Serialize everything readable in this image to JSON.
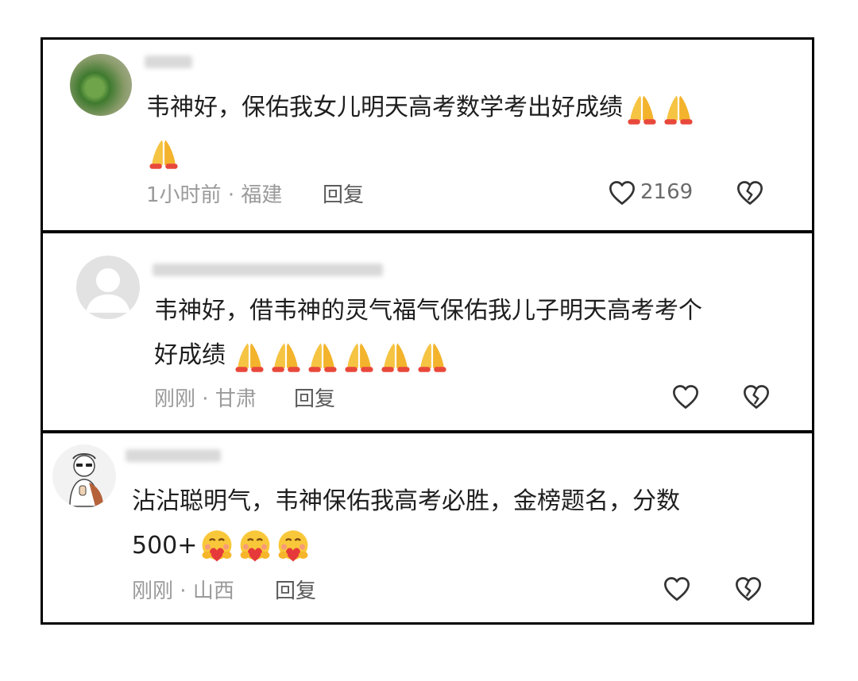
{
  "comments": [
    {
      "line1": "韦神好，保佑我女儿明天高考数学考出好成绩",
      "line2": "",
      "time": "1小时前",
      "location": "福建",
      "reply": "回复",
      "likes": "2169"
    },
    {
      "line1": "韦神好，借韦神的灵气福气保佑我儿子明天高考考个",
      "line2": "好成绩",
      "time": "刚刚",
      "location": "甘肃",
      "reply": "回复"
    },
    {
      "line1": "沾沾聪明气，韦神保佑我高考必胜，金榜题名，分数",
      "line2": "500+",
      "time": "刚刚",
      "location": "山西",
      "reply": "回复"
    }
  ],
  "separator": "·",
  "icons": {
    "like": "heart-outline-icon",
    "dislike": "broken-heart-icon",
    "pray": "praying-hands-emoji",
    "hug": "hugging-face-emoji"
  },
  "colors": {
    "text": "#1e1e1e",
    "meta": "#9a9a9a",
    "border": "#000000",
    "emoji": "#f5b82e"
  }
}
